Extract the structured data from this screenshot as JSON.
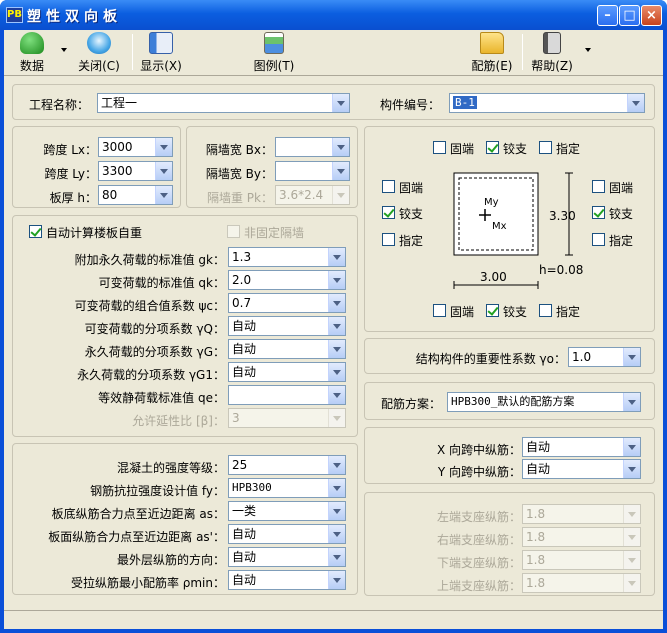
{
  "window": {
    "logo": "PB",
    "title": "塑性双向板"
  },
  "toolbar": {
    "data": "数据",
    "close": "关闭(C)",
    "display": "显示(X)",
    "legend": "图例(T)",
    "rebar": "配筋(E)",
    "help": "帮助(Z)"
  },
  "project": {
    "name_label": "工程名称：",
    "name_value": "工程一",
    "member_label": "构件编号：",
    "member_value": "B-1"
  },
  "dims": {
    "lx_label": "跨度 Lx：",
    "lx_value": "3000",
    "ly_label": "跨度 Ly：",
    "ly_value": "3300",
    "h_label": "板厚 h：",
    "h_value": "80",
    "bx_label": "隔墙宽 Bx：",
    "bx_value": "",
    "by_label": "隔墙宽 By：",
    "by_value": "",
    "pk_label": "隔墙重 Pk：",
    "pk_value": "3.6*2.4"
  },
  "supports": {
    "fixed": "固端",
    "hinged": "铰支",
    "specified": "指定",
    "top": {
      "fixed": false,
      "hinged": true,
      "specified": false
    },
    "bottom": {
      "fixed": false,
      "hinged": true,
      "specified": false
    },
    "left": {
      "fixed": false,
      "hinged": true,
      "specified": false
    },
    "right": {
      "fixed": false,
      "hinged": true,
      "specified": false
    }
  },
  "diagram": {
    "my": "My",
    "mx": "Mx",
    "dim_y": "3.30",
    "dim_x": "3.00",
    "thickness": "h=0.08"
  },
  "loads": {
    "auto_weight_label": "自动计算楼板自重",
    "auto_weight_checked": true,
    "non_fixed_wall_label": "非固定隔墙",
    "non_fixed_wall_checked": false,
    "rows": [
      {
        "label": "附加永久荷载的标准值 gk：",
        "value": "1.3"
      },
      {
        "label": "可变荷载的标准值 qk：",
        "value": "2.0"
      },
      {
        "label": "可变荷载的组合值系数 ψc：",
        "value": "0.7"
      },
      {
        "label": "可变荷载的分项系数 γQ：",
        "value": "自动"
      },
      {
        "label": "永久荷载的分项系数 γG：",
        "value": "自动"
      },
      {
        "label": "永久荷载的分项系数 γG1：",
        "value": "自动"
      },
      {
        "label": "等效静荷载标准值 qe：",
        "value": ""
      },
      {
        "label": "允许延性比 [β]：",
        "value": "3"
      }
    ]
  },
  "importance": {
    "label": "结构构件的重要性系数 γo：",
    "value": "1.0"
  },
  "scheme": {
    "label": "配筋方案：",
    "value": "HPB300_默认的配筋方案"
  },
  "mid_rebar": {
    "x_label": "X 向跨中纵筋：",
    "x_value": "自动",
    "y_label": "Y 向跨中纵筋：",
    "y_value": "自动"
  },
  "material": {
    "rows": [
      {
        "label": "混凝土的强度等级：",
        "value": "25"
      },
      {
        "label": "钢筋抗拉强度设计值 fy：",
        "value": "HPB300"
      },
      {
        "label": "板底纵筋合力点至近边距离 as：",
        "value": "一类"
      },
      {
        "label": "板面纵筋合力点至近边距离 as'：",
        "value": "自动"
      },
      {
        "label": "最外层纵筋的方向：",
        "value": "自动"
      },
      {
        "label": "受拉纵筋最小配筋率 ρmin：",
        "value": "自动"
      }
    ]
  },
  "end_rebar": {
    "rows": [
      {
        "label": "左端支座纵筋：",
        "value": "1.8"
      },
      {
        "label": "右端支座纵筋：",
        "value": "1.8"
      },
      {
        "label": "下端支座纵筋：",
        "value": "1.8"
      },
      {
        "label": "上端支座纵筋：",
        "value": "1.8"
      }
    ]
  }
}
